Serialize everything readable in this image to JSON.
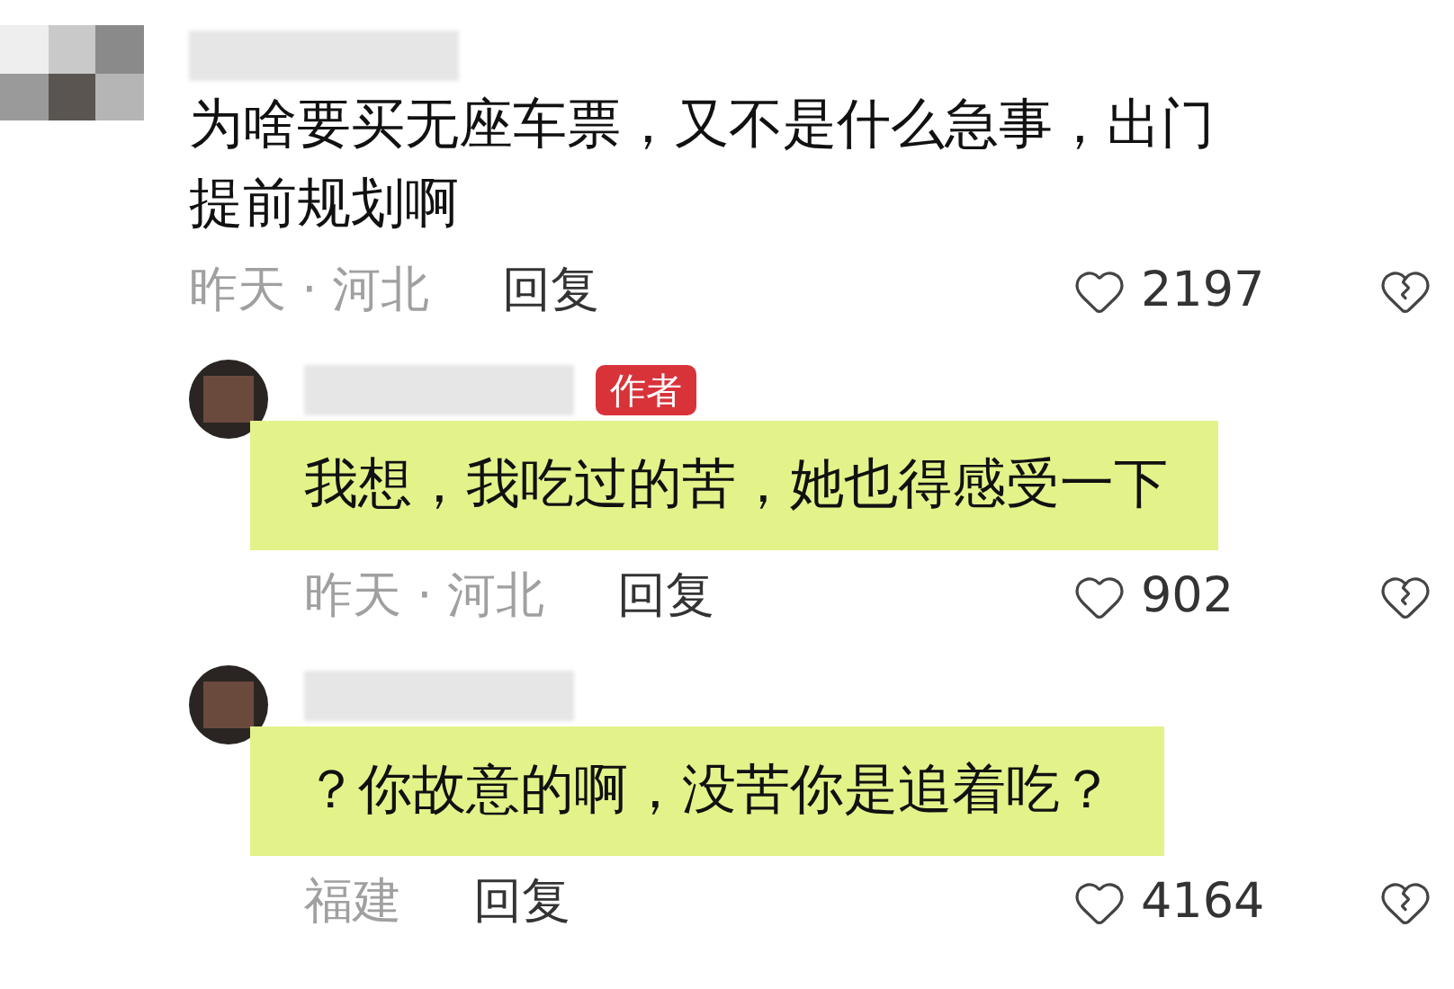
{
  "comments": [
    {
      "kind": "comment",
      "highlighted": false,
      "text": "为啥要买无座车票，又不是什么急事，出门提前规划啊",
      "meta": "昨天 · 河北",
      "reply": "回复",
      "likes": "2197"
    },
    {
      "kind": "reply",
      "highlighted": true,
      "badge": "作者",
      "text": "我想，我吃过的苦，她也得感受一下",
      "meta": "昨天 · 河北",
      "reply": "回复",
      "likes": "902"
    },
    {
      "kind": "reply",
      "highlighted": true,
      "text": "？你故意的啊，没苦你是追着吃？",
      "meta": "福建",
      "reply": "回复",
      "likes": "4164"
    }
  ]
}
